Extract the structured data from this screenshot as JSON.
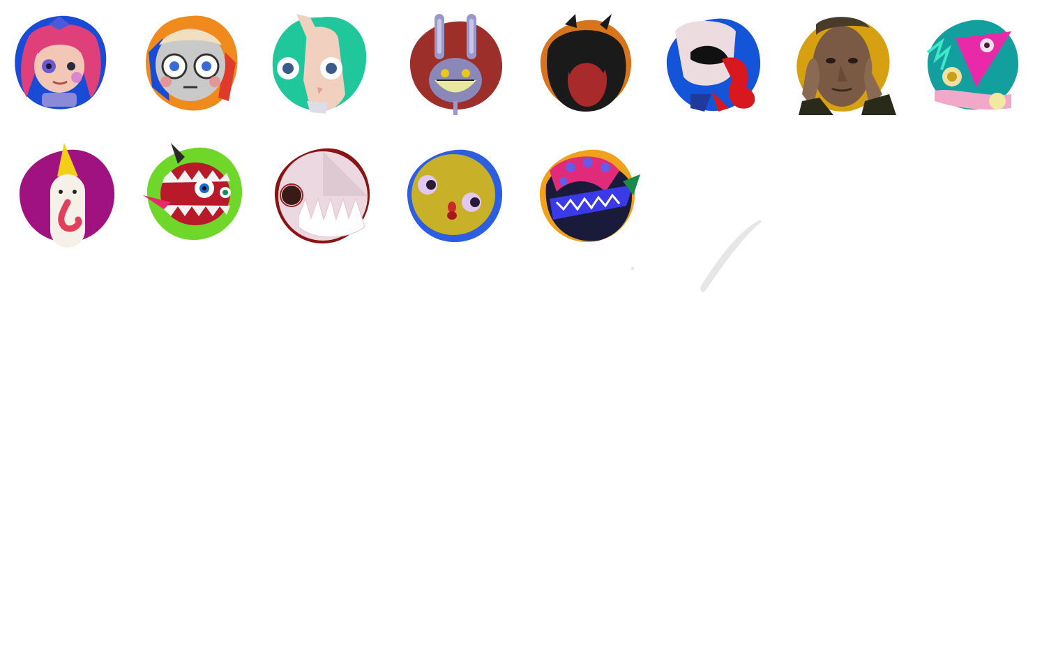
{
  "avatars": [
    {
      "id": "avatar-1",
      "bg": "#1a4bd6",
      "icon": "red-yarn-hair-character-icon"
    },
    {
      "id": "avatar-2",
      "bg": "#f08a1c",
      "icon": "gray-round-face-character-icon"
    },
    {
      "id": "avatar-3",
      "bg": "#1fc79a",
      "icon": "pale-wooden-puppet-character-icon"
    },
    {
      "id": "avatar-4",
      "bg": "#9c2f2a",
      "icon": "gray-rabbit-grin-character-icon"
    },
    {
      "id": "avatar-5",
      "bg": "#d8741c",
      "icon": "dark-haired-character-icon"
    },
    {
      "id": "avatar-6",
      "bg": "#1454d8",
      "icon": "white-mask-ribbon-character-icon"
    },
    {
      "id": "avatar-7",
      "bg": "#d6a012",
      "icon": "human-face-photo-icon"
    },
    {
      "id": "avatar-8",
      "bg": "#149f9f",
      "icon": "pink-triangle-eye-character-icon"
    },
    {
      "id": "avatar-9",
      "bg": "#a0127f",
      "icon": "party-hat-clown-character-icon"
    },
    {
      "id": "avatar-10",
      "bg": "#6fd62a",
      "icon": "teeth-monster-character-icon"
    },
    {
      "id": "avatar-11",
      "bg": "#8a1414",
      "icon": "white-teeth-ball-character-icon"
    },
    {
      "id": "avatar-12",
      "bg": "#2b5ee0",
      "icon": "yellow-round-eyes-character-icon"
    },
    {
      "id": "avatar-13",
      "bg": "#f0a21c",
      "icon": "blue-spiky-creature-character-icon"
    }
  ],
  "colors": {
    "background": "#ffffff",
    "stroke_mark": "#e6e6e6"
  }
}
